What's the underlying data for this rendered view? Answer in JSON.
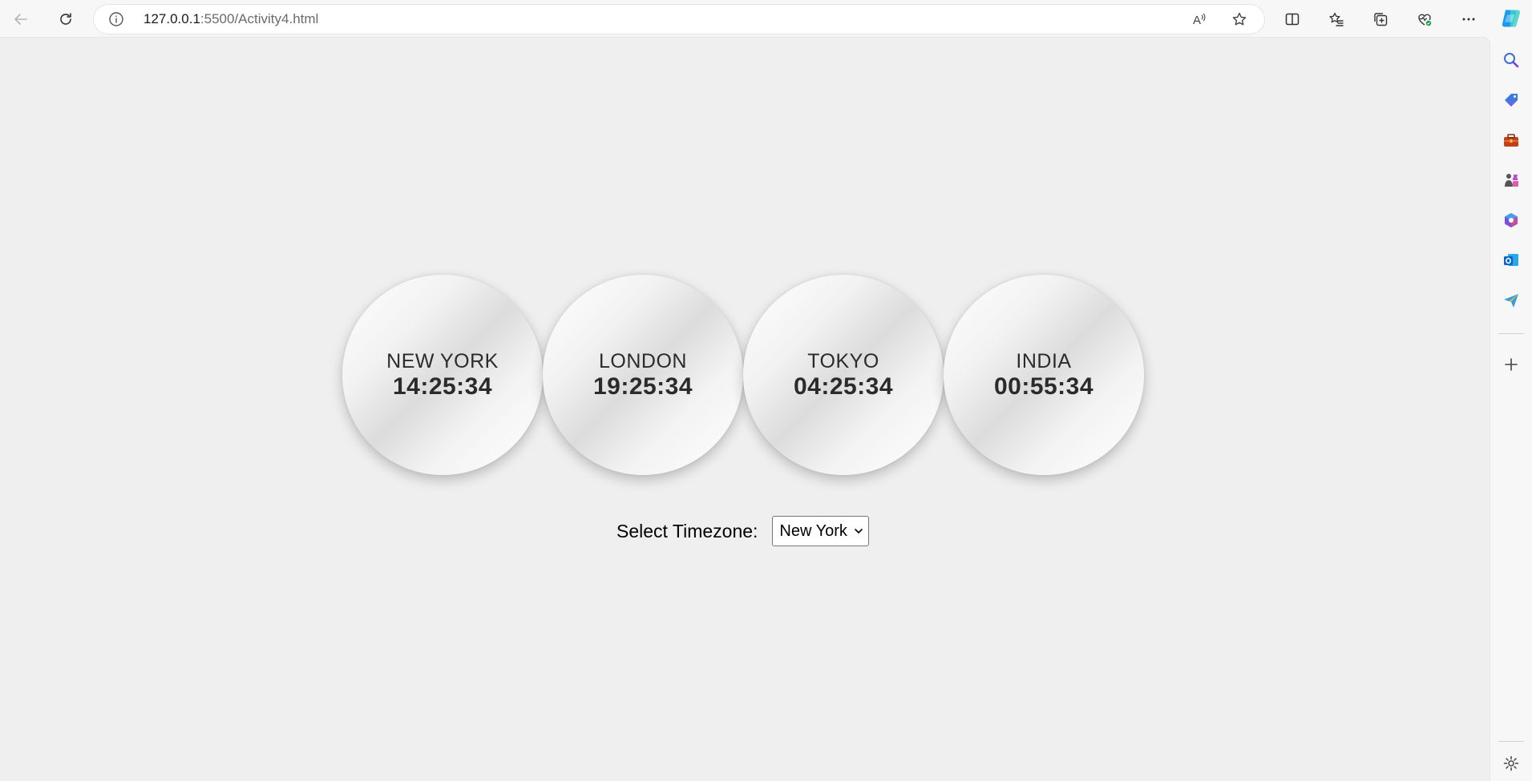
{
  "browser": {
    "url_host": "127.0.0.1",
    "url_path": ":5500/Activity4.html"
  },
  "clocks": [
    {
      "city": "NEW YORK",
      "time": "14:25:34"
    },
    {
      "city": "LONDON",
      "time": "19:25:34"
    },
    {
      "city": "TOKYO",
      "time": "04:25:34"
    },
    {
      "city": "INDIA",
      "time": "00:55:34"
    }
  ],
  "timezone": {
    "label": "Select Timezone:",
    "selected": "New York"
  },
  "sidebar_icons": [
    "search-icon",
    "shopping-tag-icon",
    "tools-icon",
    "games-icon",
    "office-icon",
    "outlook-icon",
    "send-icon",
    "add-icon",
    "settings-icon"
  ],
  "colors": {
    "page_bg": "#efefef",
    "clock_text": "#2b2b2b",
    "copilot": "#1a9bf0"
  }
}
